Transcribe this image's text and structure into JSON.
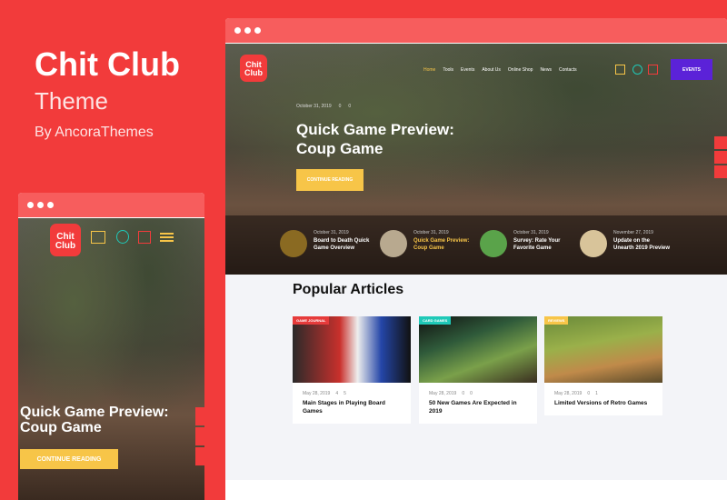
{
  "brand": {
    "title": "Chit Club",
    "subtitle": "Theme",
    "by": "By AncoraThemes"
  },
  "logo": {
    "line1": "Chit",
    "line2": "Club"
  },
  "nav": [
    "Home",
    "Tools",
    "Events",
    "About Us",
    "Online Shop",
    "News",
    "Contacts"
  ],
  "events_button": "EVENTS",
  "hero": {
    "date": "October 31, 2019",
    "comments": "0",
    "likes": "0",
    "title_line1": "Quick Game Preview:",
    "title_line2": "Coup Game",
    "cta": "CONTINUE READING"
  },
  "strip": [
    {
      "date": "October 31, 2019",
      "title": "Board to Death Quick Game Overview"
    },
    {
      "date": "October 31, 2019",
      "title": "Quick Game Preview: Coup Game"
    },
    {
      "date": "October 31, 2019",
      "title": "Survey: Rate Your Favorite Game"
    },
    {
      "date": "November 27, 2019",
      "title": "Update on the Unearth 2019 Preview"
    }
  ],
  "popular": {
    "heading": "Popular Articles",
    "cards": [
      {
        "tag": "GAME JOURNAL",
        "tag_color": "#e63b3b",
        "date": "May 28, 2019",
        "comments": "4",
        "likes": "5",
        "title": "Main Stages in Playing Board Games"
      },
      {
        "tag": "CARD GAMES",
        "tag_color": "#1fc9b8",
        "date": "May 28, 2019",
        "comments": "0",
        "likes": "0",
        "title": "50 New Games Are Expected in 2019"
      },
      {
        "tag": "REVIEWS",
        "tag_color": "#f7c548",
        "date": "May 28, 2019",
        "comments": "0",
        "likes": "1",
        "title": "Limited Versions of Retro Games"
      }
    ]
  },
  "colors": {
    "accent": "#f23b3b",
    "yellow": "#f7c548",
    "purple": "#5b22d8",
    "teal": "#1fc9b8"
  }
}
